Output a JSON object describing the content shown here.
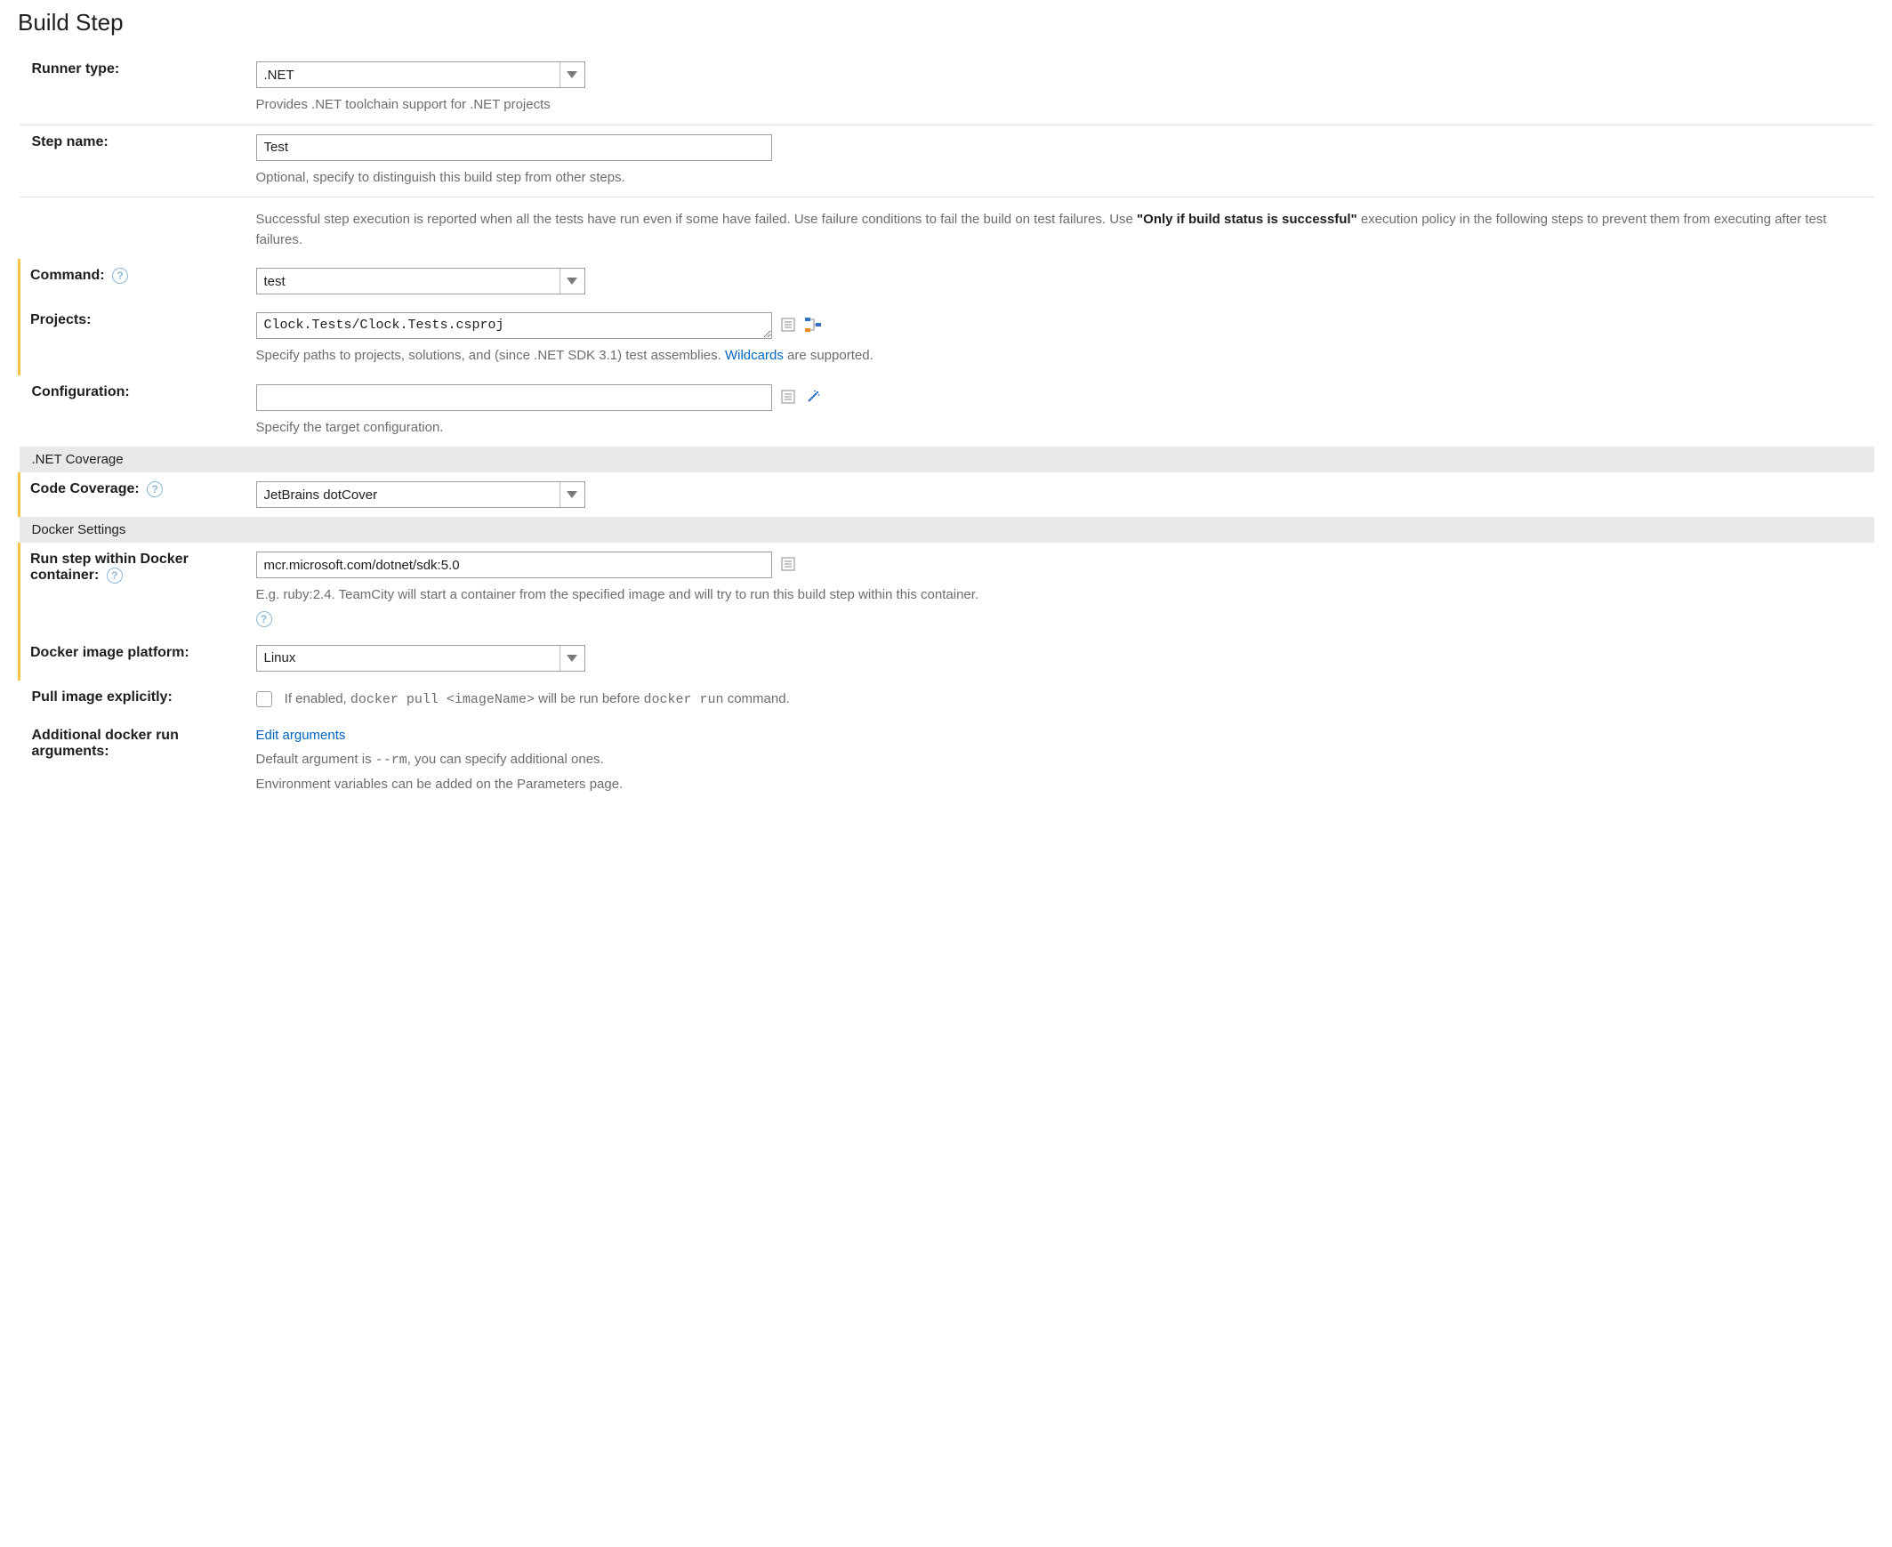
{
  "page_title": "Build Step",
  "fields": {
    "runner_type": {
      "label": "Runner type:",
      "value": ".NET",
      "help": "Provides .NET toolchain support for .NET projects"
    },
    "step_name": {
      "label": "Step name:",
      "value": "Test",
      "help": "Optional, specify to distinguish this build step from other steps."
    },
    "info_note": {
      "pre": "Successful step execution is reported when all the tests have run even if some have failed. Use failure conditions to fail the build on test failures. Use ",
      "bold": "\"Only if build status is successful\"",
      "post": " execution policy in the following steps to prevent them from executing after test failures."
    },
    "command": {
      "label": "Command:",
      "value": "test"
    },
    "projects": {
      "label": "Projects:",
      "value": "Clock.Tests/Clock.Tests.csproj",
      "help_pre": "Specify paths to projects, solutions, and (since .NET SDK 3.1) test assemblies. ",
      "help_link": "Wildcards",
      "help_post": " are supported."
    },
    "configuration": {
      "label": "Configuration:",
      "value": "",
      "help": "Specify the target configuration."
    }
  },
  "sections": {
    "coverage": {
      "header": ".NET Coverage",
      "code_coverage": {
        "label": "Code Coverage:",
        "value": "JetBrains dotCover"
      }
    },
    "docker": {
      "header": "Docker Settings",
      "container": {
        "label_l1": "Run step within Docker",
        "label_l2": "container:",
        "value": "mcr.microsoft.com/dotnet/sdk:5.0",
        "help": "E.g. ruby:2.4. TeamCity will start a container from the specified image and will try to run this build step within this container."
      },
      "platform": {
        "label": "Docker image platform:",
        "value": "Linux"
      },
      "pull": {
        "label": "Pull image explicitly:",
        "checked": false,
        "help_pre": "If enabled, ",
        "help_code1": "docker pull <imageName>",
        "help_mid": " will be run before ",
        "help_code2": "docker run",
        "help_post": " command."
      },
      "args": {
        "label_l1": "Additional docker run",
        "label_l2": "arguments:",
        "link": "Edit arguments",
        "help1_pre": "Default argument is ",
        "help1_code": "--rm",
        "help1_post": ", you can specify additional ones.",
        "help2": "Environment variables can be added on the Parameters page."
      }
    }
  }
}
